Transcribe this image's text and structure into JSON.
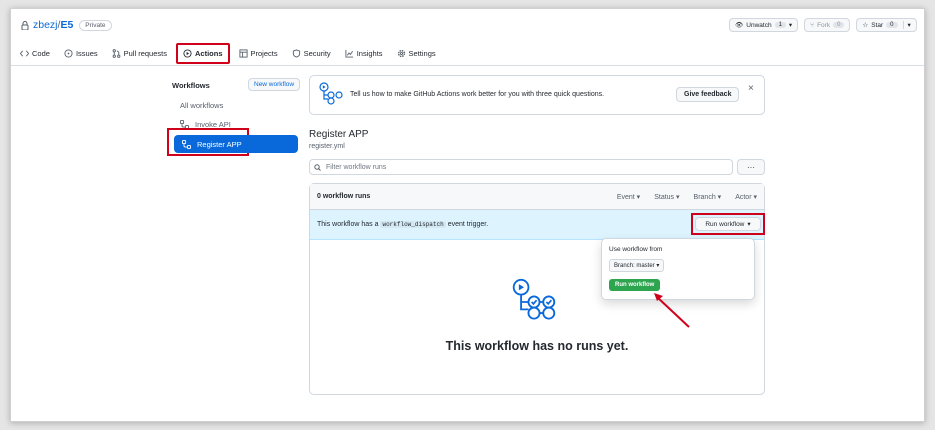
{
  "repo": {
    "owner": "zbezj",
    "separator": " / ",
    "name": "E5",
    "visibility": "Private"
  },
  "header_buttons": [
    {
      "label": "Unwatch",
      "count": "1"
    },
    {
      "label": "Fork",
      "count": "0"
    },
    {
      "label": "Star",
      "count": "0"
    }
  ],
  "tabs": [
    {
      "label": "Code",
      "icon": "code-icon"
    },
    {
      "label": "Issues",
      "icon": "issue-icon"
    },
    {
      "label": "Pull requests",
      "icon": "pull-request-icon"
    },
    {
      "label": "Actions",
      "icon": "play-icon",
      "active": true
    },
    {
      "label": "Projects",
      "icon": "table-icon"
    },
    {
      "label": "Security",
      "icon": "shield-icon"
    },
    {
      "label": "Insights",
      "icon": "graph-icon"
    },
    {
      "label": "Settings",
      "icon": "gear-icon"
    }
  ],
  "sidebar": {
    "title": "Workflows",
    "new_workflow": "New workflow",
    "all_workflows": "All workflows",
    "items": [
      {
        "label": "Invoke API",
        "icon": "workflow-icon"
      },
      {
        "label": "Register APP",
        "icon": "workflow-icon",
        "selected": true
      }
    ]
  },
  "banner": {
    "text": "Tell us how to make GitHub Actions work better for you with three quick questions.",
    "button": "Give feedback",
    "close": "×"
  },
  "workflow": {
    "title": "Register APP",
    "file": "register.yml",
    "filter_placeholder": "Filter workflow runs",
    "more": "···"
  },
  "runs": {
    "count_label": "0 workflow runs",
    "filters": [
      "Event",
      "Status",
      "Branch",
      "Actor"
    ],
    "dispatch_pre": "This workflow has a",
    "dispatch_code": "workflow_dispatch",
    "dispatch_post": "event trigger.",
    "run_workflow": "Run workflow",
    "empty": "This workflow has no runs yet."
  },
  "popup": {
    "title": "Use workflow from",
    "branch": "Branch: master",
    "run_button": "Run workflow"
  },
  "colors": {
    "accent": "#0969da",
    "highlight": "#d0021b",
    "green": "#2da44e"
  }
}
